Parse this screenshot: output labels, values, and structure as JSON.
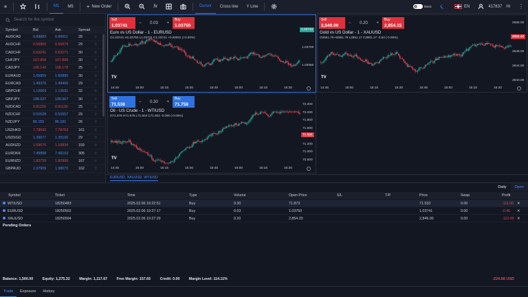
{
  "toolbar": {
    "timeframes": [
      "M1",
      "M5"
    ],
    "new_order": "New Order",
    "tools": [
      "Cursor",
      "Cross line",
      "Y Line"
    ],
    "theme_label": "Basic",
    "language": "EN",
    "account": "417837",
    "greeting": "Hi"
  },
  "market_watch": {
    "search_placeholder": "Search for the symbol",
    "headers": {
      "symbol": "Symbol",
      "bid": "Bid",
      "ask": "Ask",
      "spread": "Spread"
    },
    "rows": [
      {
        "symbol": "AUDCAD",
        "bid": "0.89883",
        "ask": "0.89911",
        "spread": "28",
        "dir": "up"
      },
      {
        "symbol": "AUDCHF",
        "bid": "0.56850",
        "ask": "0.56879",
        "spread": "29",
        "dir": "dn"
      },
      {
        "symbol": "CADCHF",
        "bid": "0.63241",
        "ask": "0.63271",
        "spread": "30",
        "dir": "dn"
      },
      {
        "symbol": "CHFJPY",
        "bid": "167.858",
        "ask": "167.888",
        "spread": "30",
        "dir": "dn"
      },
      {
        "symbol": "CADJPY",
        "bid": "106.149",
        "ask": "106.178",
        "spread": "25",
        "dir": "dn"
      },
      {
        "symbol": "EURAUD",
        "bid": "1.65855",
        "ask": "1.65885",
        "spread": "30",
        "dir": "up"
      },
      {
        "symbol": "EURCAD",
        "bid": "1.49376",
        "ask": "1.49405",
        "spread": "29",
        "dir": "up"
      },
      {
        "symbol": "GBPCHF",
        "bid": "1.12669",
        "ask": "1.12691",
        "spread": "32",
        "dir": "up"
      },
      {
        "symbol": "GBPJPY",
        "bid": "188.937",
        "ask": "188.967",
        "spread": "30",
        "dir": "up"
      },
      {
        "symbol": "NZDCAD",
        "bid": "0.81153",
        "ask": "0.81190",
        "spread": "25",
        "dir": "dn"
      },
      {
        "symbol": "NZDCHF",
        "bid": "0.51528",
        "ask": "0.51557",
        "spread": "29",
        "dir": "up"
      },
      {
        "symbol": "NZDJPY",
        "bid": "86.155",
        "ask": "86.181",
        "spread": "26",
        "dir": "up"
      },
      {
        "symbol": "USDHKD",
        "bid": "7.78592",
        "ask": "7.78753",
        "spread": "161",
        "dir": "dn"
      },
      {
        "symbol": "USDSGD",
        "bid": "1.35077",
        "ask": "1.35106",
        "spread": "29",
        "dir": "up"
      },
      {
        "symbol": "AUDNZD",
        "bid": "1.09675",
        "ask": "1.10834",
        "spread": "159",
        "dir": "dn"
      },
      {
        "symbol": "EURDKK",
        "bid": "7.45898",
        "ask": "7.46193",
        "spread": "305",
        "dir": "up"
      },
      {
        "symbol": "EURNZD",
        "bid": "1.82739",
        "ask": "1.82906",
        "spread": "167",
        "dir": "dn"
      },
      {
        "symbol": "GBPAUD",
        "bid": "1.97909",
        "ask": "1.98070",
        "spread": "162",
        "dir": "up"
      }
    ]
  },
  "charts": [
    {
      "title": "Euro vs US Dollar - 1 - EURUSD",
      "sell_label": "Sell",
      "sell_price": "1.03741",
      "buy_label": "Buy",
      "buy_price": "1.03750",
      "lot": "0.03",
      "ohlc": "O1.03741 H1.03750 L1.03741 C1.03741 +0.00001 (+0.00%)",
      "current_tag": "1.03741",
      "y_ticks": [
        "1.03700",
        "1.03650"
      ],
      "x_ticks": [
        "14:45",
        "15:00",
        "15:15",
        "15:30",
        "15:45",
        "16:00",
        "16:15",
        "16:30"
      ]
    },
    {
      "title": "Gold vs US Dollar - 1 - XAUUSD",
      "sell_label": "Sell",
      "sell_price": "2,849.00",
      "buy_label": "Buy",
      "buy_price": "2,854.15",
      "lot": "0.20",
      "ohlc": "O2851.79 H2851.79 L2851.17 C2851.17 -0.54 (-0.05%)",
      "current_tag": "2851.17",
      "y_ticks": [
        "2856.00",
        "2852.00",
        "2848.00",
        "2844.00",
        "2840.00"
      ],
      "x_ticks": [
        "14:45",
        "15:00",
        "15:15",
        "15:30",
        "15:45",
        "16:00",
        "16:15",
        "16:30"
      ]
    },
    {
      "title": "Oil - US Crude - 1 - WTIUSD",
      "sell_label": "Sell",
      "sell_price": "71.538",
      "buy_label": "Buy",
      "buy_price": "71.758",
      "lot": "0.30",
      "ohlc": "O71.676 H71.676 L71.604 C71.604 -0.090 (-0.06%)",
      "current_tag": "71.604",
      "y_ticks": [
        "72.200",
        "72.000",
        "71.800",
        "71.600",
        "71.400",
        "71.200",
        "71.000",
        "70.800"
      ],
      "x_ticks": [
        "14:45",
        "15:00",
        "15:15",
        "15:30",
        "15:45",
        "16:00",
        "16:15",
        "16:30"
      ]
    }
  ],
  "layout_tab": "EURUSD, XAUUSD, WTIUSD",
  "positions": {
    "headers": [
      "Symbol",
      "Ticket",
      "Time",
      "Type",
      "Volume",
      "Open Price",
      "S/L",
      "T/P",
      "Price",
      "Swap",
      "Profit"
    ],
    "rows": [
      {
        "symbol": "WTIUSD",
        "ticket": "18250483",
        "time": "2025.02.06 19:22:51",
        "type": "Buy",
        "volume": "0.30",
        "open": "71.873",
        "sl": "",
        "tp": "",
        "price": "71.533",
        "swap": "0.00",
        "profit": "-111.00"
      },
      {
        "symbol": "EURUSD",
        "ticket": "18250502",
        "time": "2025.02.06 19:27:17",
        "type": "Buy",
        "volume": "0.03",
        "open": "1.03760",
        "sl": "",
        "tp": "",
        "price": "1.03741",
        "swap": "0.00",
        "profit": "-0.46"
      },
      {
        "symbol": "XAUUSD",
        "ticket": "18250504",
        "time": "2025.02.06 19:27:29",
        "type": "Buy",
        "volume": "0.20",
        "open": "2,854.20",
        "sl": "",
        "tp": "",
        "price": "2,849.00",
        "swap": "0.00",
        "profit": "-113.00"
      }
    ]
  },
  "pending_label": "Pending Orders",
  "tabs_right": [
    "Daily",
    "Open"
  ],
  "account_bar": {
    "balance": "Balance: 1,500.00",
    "equity": "Equity: 1,275.32",
    "margin": "Margin: 1,117.67",
    "free_margin": "Free Margin: 157.65",
    "credit": "Credit: 0.00",
    "margin_level": "Margin Level: 114.11%",
    "total": "-224.68 USD"
  },
  "footer_tabs": [
    "Trade",
    "Exposure",
    "History"
  ],
  "colors": {
    "bg": "#131722",
    "up": "#26a69a",
    "down": "#e0464f",
    "accent": "#3b82f6"
  }
}
